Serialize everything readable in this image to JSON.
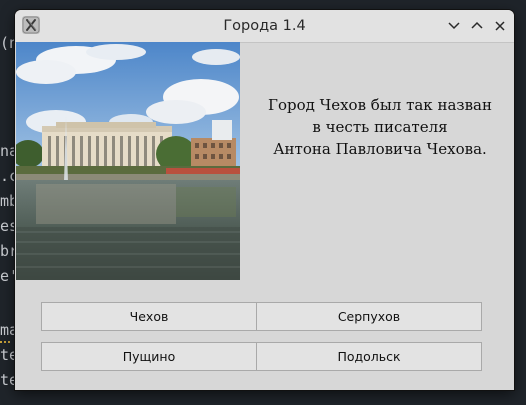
{
  "background": {
    "lines": [
      "(n",
      "na",
      ".c",
      "mb",
      "es",
      "br",
      "e'",
      "ma",
      "te",
      "te"
    ]
  },
  "window": {
    "title": "Города 1.4",
    "icons": {
      "app": "app-x-icon",
      "minimize": "chevron-down-icon",
      "maximize": "chevron-up-icon",
      "close": "close-icon"
    }
  },
  "caption": {
    "lines": [
      "Город Чехов был так назван",
      "в честь писателя",
      "Антона Павловича Чехова."
    ]
  },
  "buttons": {
    "chekhov": "Чехов",
    "serpukhov": "Серпухов",
    "pushchino": "Пущино",
    "podolsk": "Подольск"
  },
  "colors": {
    "window_bg": "#d7d7d7",
    "titlebar_bg": "#e2e2e2",
    "button_bg": "#e3e3e3",
    "button_border": "#a9a9a9"
  }
}
